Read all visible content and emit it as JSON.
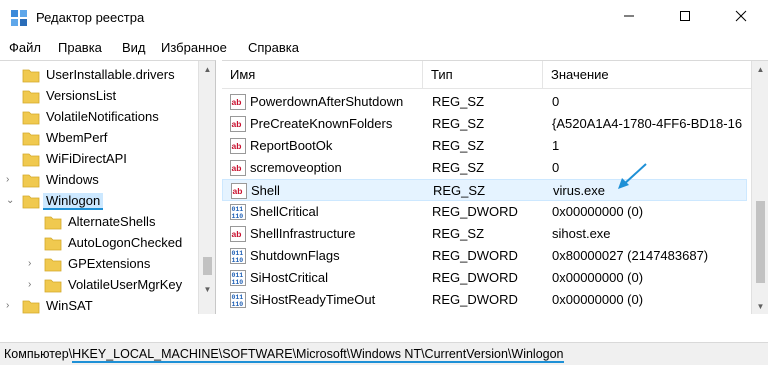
{
  "window": {
    "title": "Редактор реестра"
  },
  "menu": [
    "Файл",
    "Правка",
    "Вид",
    "Избранное",
    "Справка"
  ],
  "tree": {
    "items": [
      {
        "label": "UserInstallable.drivers",
        "has_children": false,
        "selected": false
      },
      {
        "label": "VersionsList",
        "has_children": false,
        "selected": false
      },
      {
        "label": "VolatileNotifications",
        "has_children": false,
        "selected": false
      },
      {
        "label": "WbemPerf",
        "has_children": false,
        "selected": false
      },
      {
        "label": "WiFiDirectAPI",
        "has_children": false,
        "selected": false
      },
      {
        "label": "Windows",
        "has_children": true,
        "selected": false
      },
      {
        "label": "Winlogon",
        "has_children": true,
        "selected": true
      },
      {
        "label": "AlternateShells",
        "has_children": false,
        "selected": false
      },
      {
        "label": "AutoLogonChecked",
        "has_children": false,
        "selected": false
      },
      {
        "label": "GPExtensions",
        "has_children": true,
        "selected": false
      },
      {
        "label": "VolatileUserMgrKey",
        "has_children": true,
        "selected": false
      },
      {
        "label": "WinSAT",
        "has_children": true,
        "selected": false
      }
    ]
  },
  "values": {
    "headers": {
      "name": "Имя",
      "type": "Тип",
      "data": "Значение"
    },
    "rows": [
      {
        "icon": "string-value-icon",
        "name": "PowerdownAfterShutdown",
        "type": "REG_SZ",
        "data": "0"
      },
      {
        "icon": "string-value-icon",
        "name": "PreCreateKnownFolders",
        "type": "REG_SZ",
        "data": "{A520A1A4-1780-4FF6-BD18-16"
      },
      {
        "icon": "string-value-icon",
        "name": "ReportBootOk",
        "type": "REG_SZ",
        "data": "1"
      },
      {
        "icon": "string-value-icon",
        "name": "scremoveoption",
        "type": "REG_SZ",
        "data": "0"
      },
      {
        "icon": "string-value-icon",
        "name": "Shell",
        "type": "REG_SZ",
        "data": "virus.exe"
      },
      {
        "icon": "binary-value-icon",
        "name": "ShellCritical",
        "type": "REG_DWORD",
        "data": "0x00000000 (0)"
      },
      {
        "icon": "string-value-icon",
        "name": "ShellInfrastructure",
        "type": "REG_SZ",
        "data": "sihost.exe"
      },
      {
        "icon": "binary-value-icon",
        "name": "ShutdownFlags",
        "type": "REG_DWORD",
        "data": "0x80000027 (2147483687)"
      },
      {
        "icon": "binary-value-icon",
        "name": "SiHostCritical",
        "type": "REG_DWORD",
        "data": "0x00000000 (0)"
      },
      {
        "icon": "binary-value-icon",
        "name": "SiHostReadyTimeOut",
        "type": "REG_DWORD",
        "data": "0x00000000 (0)"
      }
    ]
  },
  "status": {
    "prefix": "Компьютер\\",
    "path": "HKEY_LOCAL_MACHINE\\SOFTWARE\\Microsoft\\Windows NT\\CurrentVersion\\Winlogon"
  },
  "colors": {
    "selection": "#cce8ff",
    "folder": "#f0c94f",
    "annotation": "#1e90d6"
  }
}
